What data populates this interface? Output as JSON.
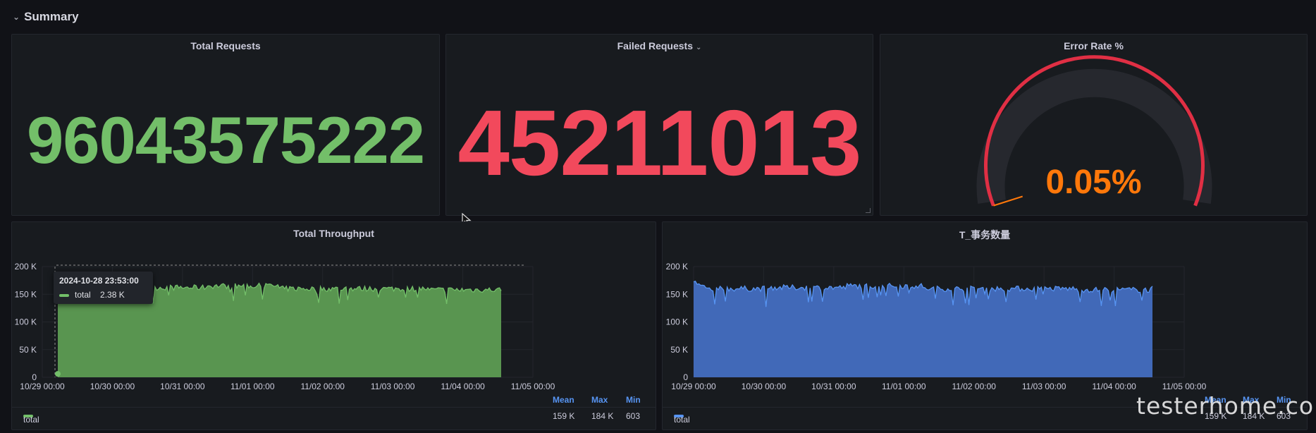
{
  "row": {
    "title": "Summary"
  },
  "panels": {
    "total_requests": {
      "title": "Total Requests",
      "value": "96043575222",
      "color": "#73bf69"
    },
    "failed_requests": {
      "title": "Failed Requests",
      "value": "45211013",
      "color": "#f2495c"
    },
    "error_rate": {
      "title": "Error Rate %",
      "value": "0.05%",
      "fraction": 0.0005,
      "color": "#ff780a",
      "arc_color": "#e02f44"
    }
  },
  "charts": {
    "total_throughput": {
      "title": "Total Throughput",
      "tooltip": {
        "time": "2024-10-28 23:53:00",
        "series": "total",
        "value": "2.38 K"
      },
      "legend": {
        "headers": [
          "Mean",
          "Max",
          "Min"
        ],
        "series": "total",
        "mean": "159 K",
        "max": "184 K",
        "min": "603"
      }
    },
    "tx_count": {
      "title": "T_事务数量",
      "legend": {
        "headers": [
          "Mean",
          "Max",
          "Min"
        ],
        "series": "total",
        "mean": "159 K",
        "max": "184 K",
        "min": "603"
      }
    }
  },
  "chart_data": [
    {
      "type": "area",
      "title": "Total Throughput",
      "x": [
        "10/29 00:00",
        "10/30 00:00",
        "10/31 00:00",
        "11/01 00:00",
        "11/02 00:00",
        "11/03 00:00",
        "11/04 00:00",
        "11/05 00:00"
      ],
      "y_ticks": [
        "0",
        "50 K",
        "100 K",
        "150 K",
        "200 K"
      ],
      "ylim": [
        0,
        200000
      ],
      "color": "#73bf69",
      "series": [
        {
          "name": "total",
          "values": [
            2380,
            160000,
            162000,
            165000,
            160000,
            160000,
            158000,
            160000
          ]
        }
      ]
    },
    {
      "type": "area",
      "title": "T_事务数量",
      "x": [
        "10/29 00:00",
        "10/30 00:00",
        "10/31 00:00",
        "11/01 00:00",
        "11/02 00:00",
        "11/03 00:00",
        "11/04 00:00",
        "11/05 00:00"
      ],
      "y_ticks": [
        "0",
        "50 K",
        "100 K",
        "150 K",
        "200 K"
      ],
      "ylim": [
        0,
        200000
      ],
      "color": "#5794f2",
      "series": [
        {
          "name": "total",
          "values": [
            168000,
            160000,
            162000,
            165000,
            160000,
            160000,
            158000,
            160000
          ]
        }
      ]
    }
  ],
  "watermark": "testerhome.com"
}
